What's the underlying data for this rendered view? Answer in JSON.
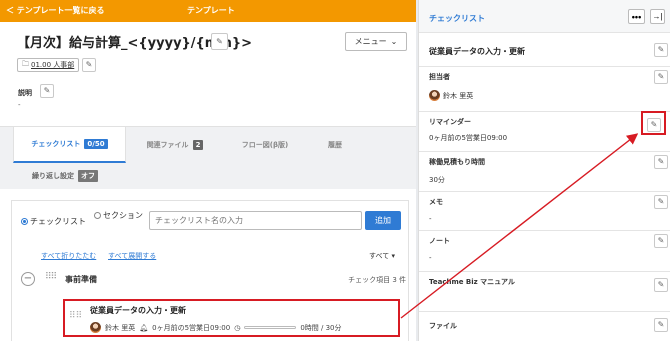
{
  "header": {
    "back_link": "＜ テンプレート一覧に戻る",
    "title": "テンプレート"
  },
  "template": {
    "name": "【月次】給与計算_<{yyyy}/{mm}>",
    "menu_label": "メニュー",
    "folder": "01.00 人事部",
    "description_label": "説明",
    "description_value": "-"
  },
  "tabs": [
    {
      "label": "チェックリスト",
      "badge": "0/50"
    },
    {
      "label": "関連ファイル",
      "badge": "2"
    },
    {
      "label": "フロー図(β版)",
      "badge": ""
    },
    {
      "label": "履歴",
      "badge": ""
    }
  ],
  "repeat_setting": {
    "label": "繰り返し設定",
    "badge": "オフ"
  },
  "search": {
    "radio_checklist": "チェックリスト",
    "radio_section": "セクション",
    "placeholder": "チェックリスト名の入力",
    "add_label": "追加"
  },
  "list_controls": {
    "collapse_all": "すべて折りたたむ",
    "expand_all": "すべて展開する",
    "filter": "すべて ▾"
  },
  "section": {
    "name": "事前準備",
    "count": "チェック項目 3 件"
  },
  "task": {
    "title": "従業員データの入力・更新",
    "assignee": "鈴木 里英",
    "reminder": "0ヶ月前の5営業日09:00",
    "time": "0時間 / 30分"
  },
  "panel": {
    "title": "チェックリスト",
    "more": "•••",
    "collapse": "→|",
    "task_name": "従業員データの入力・更新",
    "fields": [
      {
        "label": "担当者",
        "value": "鈴木 里英"
      },
      {
        "label": "リマインダー",
        "value": "0ヶ月前の5営業日09:00"
      },
      {
        "label": "稼働見積もり時間",
        "value": "30分"
      },
      {
        "label": "メモ",
        "value": "-"
      },
      {
        "label": "ノート",
        "value": "-"
      },
      {
        "label": "Teachme Biz マニュアル",
        "value": ""
      },
      {
        "label": "ファイル",
        "value": ""
      }
    ]
  },
  "colors": {
    "topbar": "#f39800",
    "accent": "#2f7bd4",
    "highlight": "#d71b23"
  }
}
